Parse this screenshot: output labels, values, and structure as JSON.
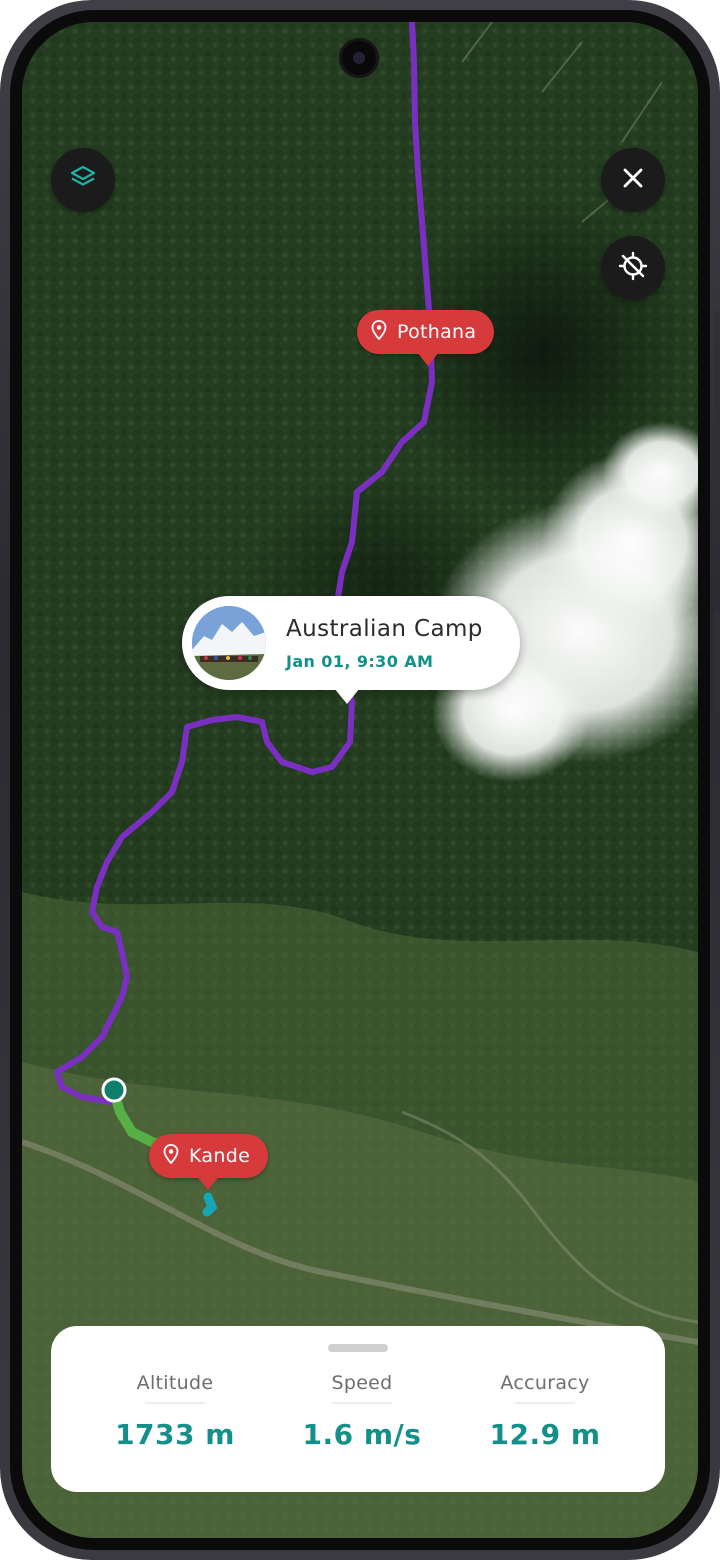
{
  "map": {
    "markers": [
      {
        "name": "Pothana"
      },
      {
        "name": "Kande"
      }
    ],
    "selected_stop": {
      "title": "Australian Camp",
      "datetime": "Jan 01, 9:30 AM"
    },
    "route_color": "#7a2fc2",
    "recent_segment_color": "#56b046",
    "end_segment_color": "#17a6b6",
    "marker_color": "#d63a3a"
  },
  "controls": {
    "layers_icon": "layers-icon",
    "close_icon": "close-icon",
    "location_icon": "location-off-icon"
  },
  "stats": {
    "items": [
      {
        "label": "Altitude",
        "value": "1733 m"
      },
      {
        "label": "Speed",
        "value": "1.6 m/s"
      },
      {
        "label": "Accuracy",
        "value": "12.9 m"
      }
    ],
    "accent_color": "#13908a"
  }
}
